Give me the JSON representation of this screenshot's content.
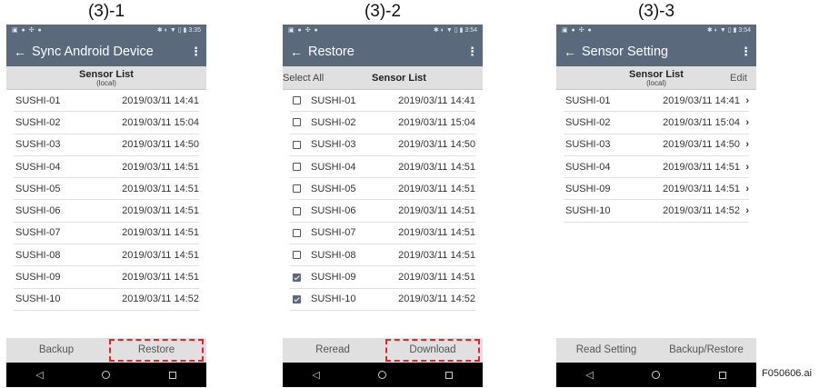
{
  "figure_code": "F050606.ai",
  "panels": [
    {
      "label": "(3)-1",
      "status": {
        "left": "▣ ● ✣ ●",
        "right": "✱ ◐ ▼ ▯ ▮ 3:35"
      },
      "appbar": {
        "back_icon": "←",
        "title": "Sync Android Device",
        "menu_icon": "⋮"
      },
      "subheader": {
        "title": "Sensor List",
        "subtitle": "(local)"
      },
      "rows": [
        {
          "name": "SUSHI-01",
          "time": "2019/03/11  14:41"
        },
        {
          "name": "SUSHI-02",
          "time": "2019/03/11  15:04"
        },
        {
          "name": "SUSHI-03",
          "time": "2019/03/11  14:50"
        },
        {
          "name": "SUSHI-04",
          "time": "2019/03/11  14:51"
        },
        {
          "name": "SUSHI-05",
          "time": "2019/03/11  14:51"
        },
        {
          "name": "SUSHI-06",
          "time": "2019/03/11  14:51"
        },
        {
          "name": "SUSHI-07",
          "time": "2019/03/11  14:51"
        },
        {
          "name": "SUSHI-08",
          "time": "2019/03/11  14:51"
        },
        {
          "name": "SUSHI-09",
          "time": "2019/03/11  14:51"
        },
        {
          "name": "SUSHI-10",
          "time": "2019/03/11  14:52"
        }
      ],
      "bottom": {
        "left": "Backup",
        "right": "Restore"
      }
    },
    {
      "label": "(3)-2",
      "status": {
        "left": "▣ ● ✣ ●",
        "right": "✱ ◐ ▼ ▯ ▮ 3:54"
      },
      "appbar": {
        "back_icon": "←",
        "title": "Restore",
        "menu_icon": "⋮"
      },
      "subheader": {
        "left_link": "Select All",
        "title": "Sensor List"
      },
      "rows": [
        {
          "name": "SUSHI-01",
          "time": "2019/03/11  14:41",
          "checked": false
        },
        {
          "name": "SUSHI-02",
          "time": "2019/03/11  15:04",
          "checked": false
        },
        {
          "name": "SUSHI-03",
          "time": "2019/03/11  14:50",
          "checked": false
        },
        {
          "name": "SUSHI-04",
          "time": "2019/03/11  14:51",
          "checked": false
        },
        {
          "name": "SUSHI-05",
          "time": "2019/03/11  14:51",
          "checked": false
        },
        {
          "name": "SUSHI-06",
          "time": "2019/03/11  14:51",
          "checked": false
        },
        {
          "name": "SUSHI-07",
          "time": "2019/03/11  14:51",
          "checked": false
        },
        {
          "name": "SUSHI-08",
          "time": "2019/03/11  14:51",
          "checked": false
        },
        {
          "name": "SUSHI-09",
          "time": "2019/03/11  14:51",
          "checked": true
        },
        {
          "name": "SUSHI-10",
          "time": "2019/03/11  14:52",
          "checked": true
        }
      ],
      "bottom": {
        "left": "Reread",
        "right": "Download"
      }
    },
    {
      "label": "(3)-3",
      "status": {
        "left": "▣ ● ✣ ●",
        "right": "✱ ◐ ▼ ▯ ▮ 3:54"
      },
      "appbar": {
        "back_icon": "←",
        "title": "Sensor Setting",
        "menu_icon": "⋮"
      },
      "subheader": {
        "title": "Sensor List",
        "subtitle": "(local)",
        "right_link": "Edit"
      },
      "rows": [
        {
          "name": "SUSHI-01",
          "time": "2019/03/11  14:41",
          "chevron": "›"
        },
        {
          "name": "SUSHI-02",
          "time": "2019/03/11  15:04",
          "chevron": "›"
        },
        {
          "name": "SUSHI-03",
          "time": "2019/03/11  14:50",
          "chevron": "›"
        },
        {
          "name": "SUSHI-04",
          "time": "2019/03/11  14:51",
          "chevron": "›"
        },
        {
          "name": "SUSHI-09",
          "time": "2019/03/11  14:51",
          "chevron": "›"
        },
        {
          "name": "SUSHI-10",
          "time": "2019/03/11  14:52",
          "chevron": "›"
        }
      ],
      "bottom": {
        "left": "Read Setting",
        "right": "Backup/Restore"
      }
    }
  ],
  "nav": {
    "back_icon": "◁"
  },
  "colors": {
    "appbar": "#5a6a7c",
    "subheader": "#e0e0e0",
    "highlight": "#e3262b",
    "navbar": "#000000"
  }
}
